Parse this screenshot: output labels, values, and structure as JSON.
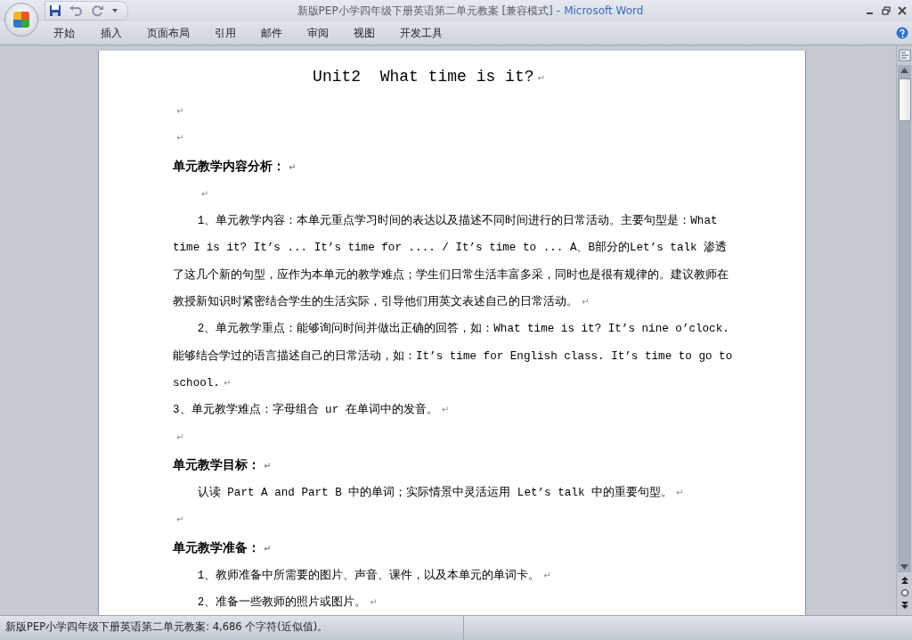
{
  "window": {
    "title": "新版PEP小学四年级下册英语第二单元教案 [兼容模式]",
    "separator": "-",
    "app": "Microsoft Word"
  },
  "ribbon_tabs": [
    "开始",
    "插入",
    "页面布局",
    "引用",
    "邮件",
    "审阅",
    "视图",
    "开发工具"
  ],
  "document": {
    "paragraphs": [
      {
        "kind": "title",
        "text": "Unit2  What time is it?",
        "mark": "↵"
      },
      {
        "kind": "empty",
        "mark": "↵"
      },
      {
        "kind": "empty",
        "mark": "↵"
      },
      {
        "kind": "heading",
        "text": "单元教学内容分析：",
        "mark": "↵"
      },
      {
        "kind": "body",
        "mark": "↵"
      },
      {
        "kind": "body",
        "text": "1、单元教学内容：本单元重点学习时间的表达以及描述不同时间进行的日常活动。主要句型是：What time is it? It’s ... It’s time for .... / It’s time to ... A、B部分的Let’s talk 渗透了这几个新的句型，应作为本单元的教学难点；学生们日常生活丰富多采，同时也是很有规律的。建议教师在教授新知识时紧密结合学生的生活实际，引导他们用英文表述自己的日常活动。",
        "mark": "↵"
      },
      {
        "kind": "body",
        "text": "2、单元教学重点：能够询问时间并做出正确的回答，如：What time is it? It’s nine o’clock.能够结合学过的语言描述自己的日常活动，如：It’s time for English class. It’s time to go to school.",
        "mark": "↵"
      },
      {
        "kind": "plain",
        "text": "3、单元教学难点：字母组合 ur 在单词中的发音。",
        "mark": "↵"
      },
      {
        "kind": "empty",
        "mark": "↵"
      },
      {
        "kind": "heading",
        "text": "单元教学目标：",
        "mark": "↵"
      },
      {
        "kind": "body",
        "text": "认读 Part A and Part B 中的单词；实际情景中灵活运用 Let’s talk 中的重要句型。",
        "mark": "↵"
      },
      {
        "kind": "empty",
        "mark": "↵"
      },
      {
        "kind": "heading",
        "text": "单元教学准备：",
        "mark": "↵"
      },
      {
        "kind": "body",
        "text": "1、教师准备中所需要的图片、声音、课件，以及本单元的单词卡。",
        "mark": "↵"
      },
      {
        "kind": "body",
        "text": "2、准备一些教师的照片或图片。",
        "mark": "↵"
      }
    ]
  },
  "status_bar": {
    "text": "新版PEP小学四年级下册英语第二单元教案: 4,686 个字符(近似值)。"
  }
}
